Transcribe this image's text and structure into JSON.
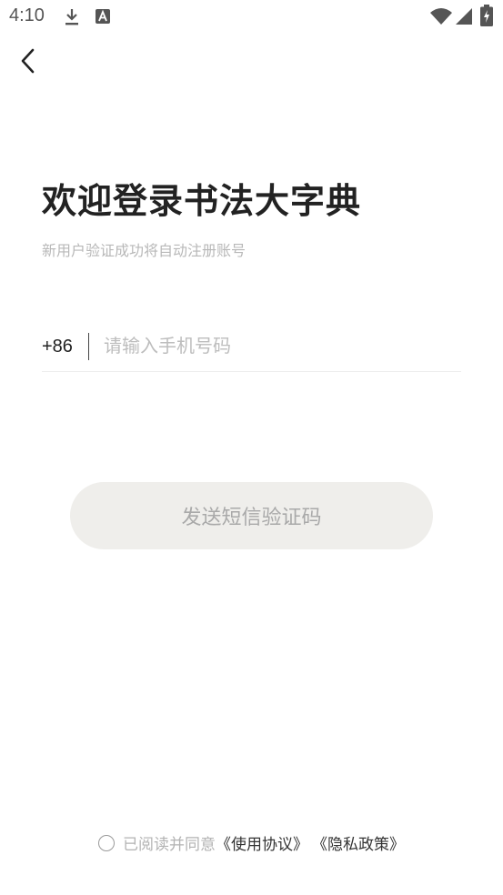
{
  "status_bar": {
    "time": "4:10",
    "icons": [
      "download-icon",
      "a-notification-icon",
      "wifi-icon",
      "signal-icon",
      "battery-charging-icon"
    ]
  },
  "nav": {
    "back_icon": "chevron-left-icon"
  },
  "header": {
    "title": "欢迎登录书法大字典",
    "subtitle": "新用户验证成功将自动注册账号"
  },
  "phone": {
    "country_code": "+86",
    "placeholder": "请输入手机号码",
    "value": ""
  },
  "send_button": {
    "label": "发送短信验证码"
  },
  "agreement": {
    "checked": false,
    "prefix": "已阅读并同意",
    "terms_link": "《使用协议》",
    "privacy_link": "《隐私政策》"
  },
  "colors": {
    "button_bg": "#efeeeb",
    "button_text": "#a9a9a9",
    "muted_text": "#b8b8b8"
  }
}
